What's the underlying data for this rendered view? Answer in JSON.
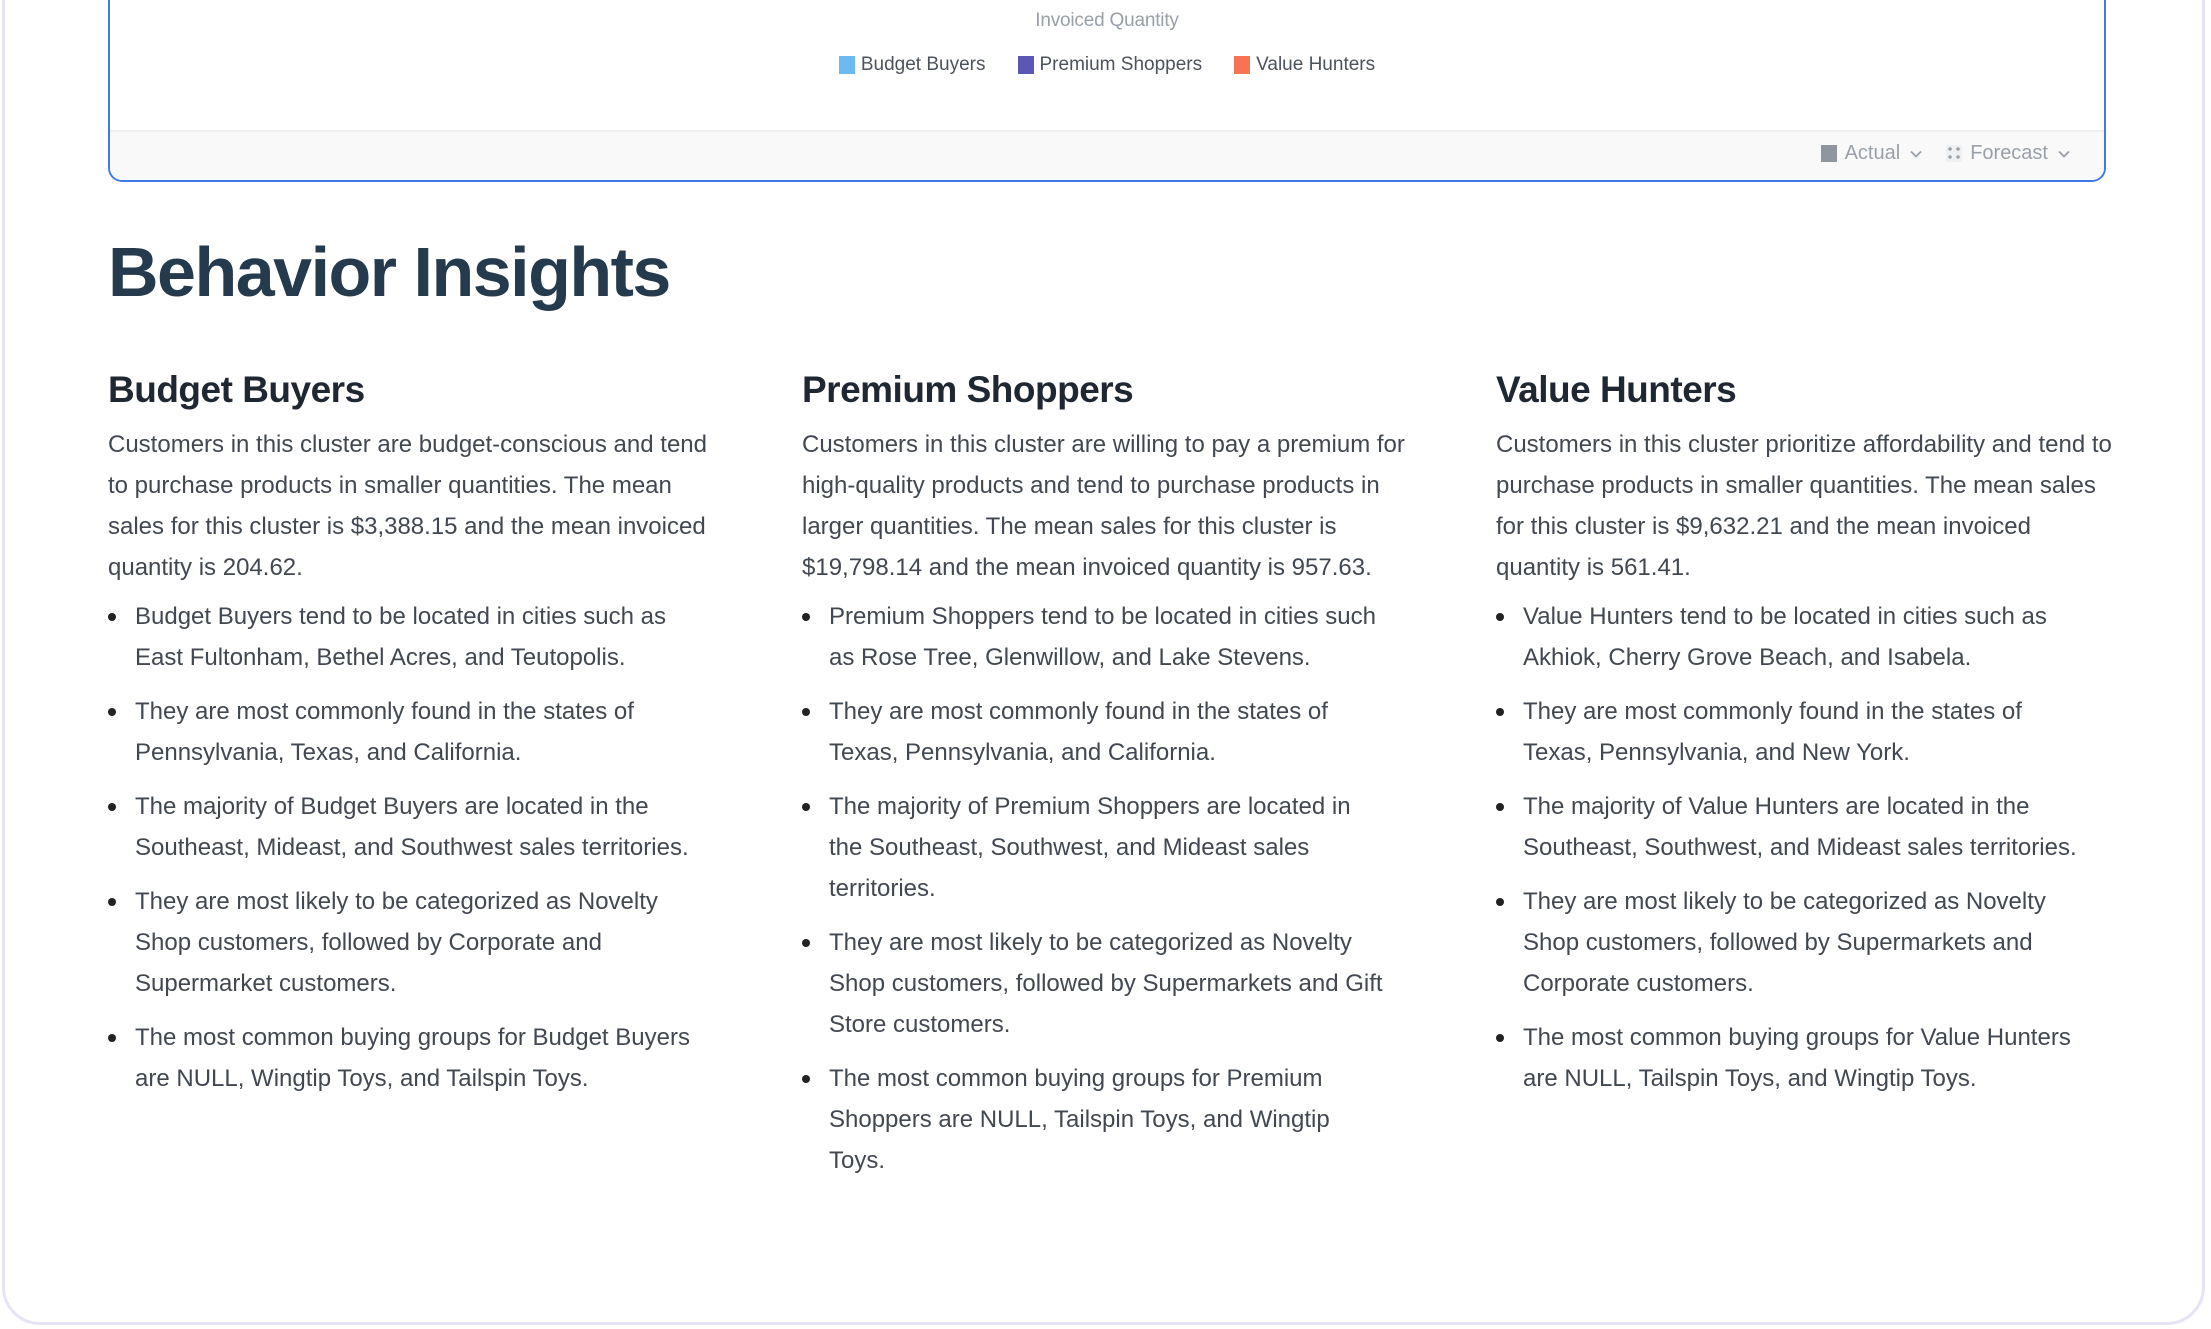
{
  "chart_card": {
    "title": "Invoiced Quantity",
    "legend": [
      {
        "label": "Budget Buyers",
        "color": "#6bbaf2"
      },
      {
        "label": "Premium Shoppers",
        "color": "#5b57b5"
      },
      {
        "label": "Value Hunters",
        "color": "#f87353"
      }
    ],
    "footer": {
      "actual_label": "Actual",
      "forecast_label": "Forecast"
    }
  },
  "page_title": "Behavior Insights",
  "clusters": [
    {
      "name": "Budget Buyers",
      "summary": "Customers in this cluster are budget-conscious and tend to purchase products in smaller quantities. The mean sales for this cluster is $3,388.15 and the mean invoiced quantity is 204.62.",
      "bullets": [
        "Budget Buyers tend to be located in cities such as East Fultonham, Bethel Acres, and Teutopolis.",
        "They are most commonly found in the states of Pennsylvania, Texas, and California.",
        "The majority of Budget Buyers are located in the Southeast, Mideast, and Southwest sales territories.",
        "They are most likely to be categorized as Novelty Shop customers, followed by Corporate and Supermarket customers.",
        "The most common buying groups for Budget Buyers are NULL, Wingtip Toys, and Tailspin Toys."
      ]
    },
    {
      "name": "Premium Shoppers",
      "summary": "Customers in this cluster are willing to pay a premium for high-quality products and tend to purchase products in larger quantities. The mean sales for this cluster is $19,798.14 and the mean invoiced quantity is 957.63.",
      "bullets": [
        "Premium Shoppers tend to be located in cities such as Rose Tree, Glenwillow, and Lake Stevens.",
        "They are most commonly found in the states of Texas, Pennsylvania, and California.",
        "The majority of Premium Shoppers are located in the Southeast, Southwest, and Mideast sales territories.",
        "They are most likely to be categorized as Novelty Shop customers, followed by Supermarkets and Gift Store customers.",
        "The most common buying groups for Premium Shoppers are NULL, Tailspin Toys, and Wingtip Toys."
      ]
    },
    {
      "name": "Value Hunters",
      "summary": "Customers in this cluster prioritize affordability and tend to purchase products in smaller quantities. The mean sales for this cluster is $9,632.21 and the mean invoiced quantity is 561.41.",
      "bullets": [
        "Value Hunters tend to be located in cities such as Akhiok, Cherry Grove Beach, and Isabela.",
        "They are most commonly found in the states of Texas, Pennsylvania, and New York.",
        "The majority of Value Hunters are located in the Southeast, Southwest, and Mideast sales territories.",
        "They are most likely to be categorized as Novelty Shop customers, followed by Supermarkets and Corporate customers.",
        "The most common buying groups for Value Hunters are NULL, Tailspin Toys, and Wingtip Toys."
      ]
    }
  ]
}
